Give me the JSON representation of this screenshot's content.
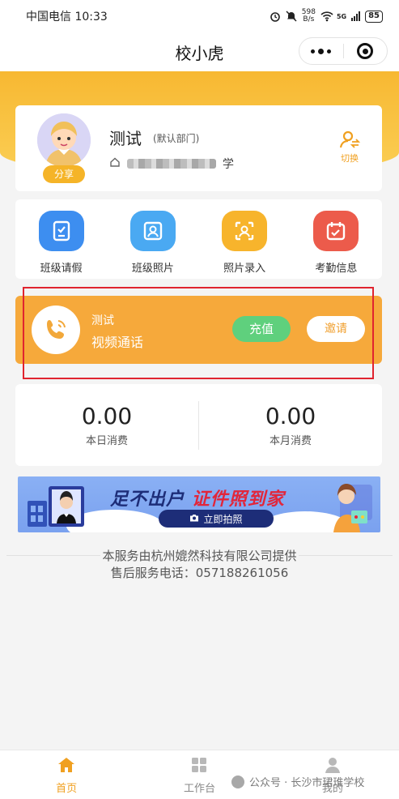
{
  "status_bar": {
    "carrier_time": "中国电信 10:33",
    "net_speed_value": "598",
    "net_speed_unit": "B/s",
    "network_type": "5G",
    "battery": "85"
  },
  "nav": {
    "title": "校小虎"
  },
  "profile": {
    "share_label": "分享",
    "name": "测试",
    "department": "(默认部门)",
    "school_suffix": "学",
    "switch_label": "切换"
  },
  "menu": {
    "items": [
      {
        "label": "班级请假",
        "icon": "leave-request-icon",
        "color": "#3d8ef0"
      },
      {
        "label": "班级照片",
        "icon": "class-photo-icon",
        "color": "#4aa9f2"
      },
      {
        "label": "照片录入",
        "icon": "photo-entry-icon",
        "color": "#f7b42c"
      },
      {
        "label": "考勤信息",
        "icon": "attendance-icon",
        "color": "#ec5b4b"
      }
    ]
  },
  "call": {
    "name": "测试",
    "title": "视频通话",
    "recharge_label": "充值",
    "invite_label": "邀请"
  },
  "stats": {
    "today_value": "0.00",
    "today_label": "本日消费",
    "month_value": "0.00",
    "month_label": "本月消费"
  },
  "banner": {
    "headline_part1": "足不出户",
    "headline_part2": "证件照到家",
    "button_label": "立即拍照"
  },
  "footer": {
    "provider": "本服务由杭州媲然科技有限公司提供",
    "hotline": "售后服务电话：057188261056"
  },
  "tabs": [
    {
      "label": "首页",
      "active": true
    },
    {
      "label": "工作台",
      "active": false
    },
    {
      "label": "我的",
      "active": false
    }
  ],
  "watermark": "公众号 · 长沙市珺琟学校",
  "colors": {
    "accent": "#f0a020",
    "header_orange": "#f7b832",
    "call_card": "#f6a93b",
    "recharge_green": "#5fd07d",
    "highlight_red": "#e0242f"
  }
}
